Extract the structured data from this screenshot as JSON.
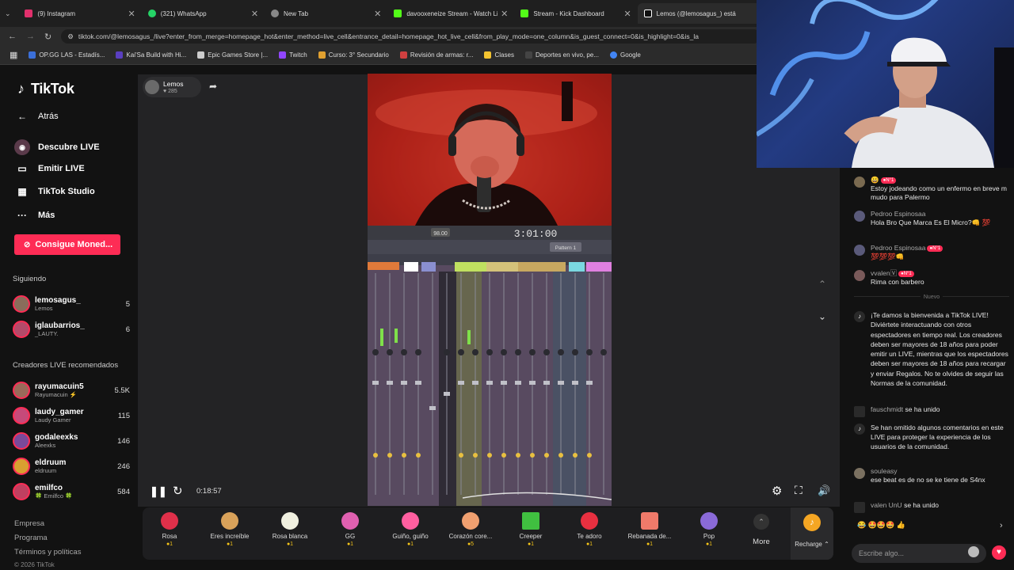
{
  "browser": {
    "tabs": [
      {
        "label": "(9) Instagram",
        "color": "#e1306c"
      },
      {
        "label": "(321) WhatsApp",
        "color": "#25d366"
      },
      {
        "label": "New Tab",
        "color": "#888888"
      },
      {
        "label": "davooxeneize Stream - Watch Live",
        "color": "#53fc18"
      },
      {
        "label": "Stream - Kick Dashboard",
        "color": "#53fc18"
      },
      {
        "label": "Lemos (@lemosagus_) está",
        "color": "#ffffff"
      }
    ],
    "url": "tiktok.com/@lemosagus_/live?enter_from_merge=homepage_hot&enter_method=live_cell&entrance_detail=homepage_hot_live_cell&from_play_mode=one_column&is_guest_connect=0&is_highlight=0&is_la",
    "bookmarks": [
      {
        "label": "OP.GG LAS - Estadís...",
        "color": "#3b6fd8"
      },
      {
        "label": "Kai'Sa Build with Hi...",
        "color": "#5a3fc0"
      },
      {
        "label": "Epic Games Store |...",
        "color": "#cccccc"
      },
      {
        "label": "Twitch",
        "color": "#9146ff"
      },
      {
        "label": "Curso: 3° Secundario",
        "color": "#e0a030"
      },
      {
        "label": "Revisión de armas: r...",
        "color": "#d04040"
      },
      {
        "label": "Clases",
        "color": "#f4c430"
      },
      {
        "label": "Deportes en vivo, pe...",
        "color": "#444444"
      },
      {
        "label": "Google",
        "color": "#4285f4"
      }
    ]
  },
  "sidebar": {
    "logo": "TikTok",
    "nav": [
      {
        "label": "Atrás",
        "icon": "arrow-left-icon",
        "glyph": "←"
      },
      {
        "label": "Descubre LIVE",
        "icon": "live-icon",
        "glyph": "◉"
      },
      {
        "label": "Emitir LIVE",
        "icon": "camera-icon",
        "glyph": "▭"
      },
      {
        "label": "TikTok Studio",
        "icon": "studio-icon",
        "glyph": "▦"
      },
      {
        "label": "Más",
        "icon": "more-icon",
        "glyph": "···"
      }
    ],
    "coins_button": "Consigue Moned...",
    "following_header": "Siguiendo",
    "following": [
      {
        "name": "lemosagus_",
        "sub": "Lemos",
        "count": "5",
        "color": "#8a6d5b"
      },
      {
        "name": "iglaubarrios_",
        "sub": "_LAUTY.",
        "count": "6",
        "color": "#b34b6a"
      }
    ],
    "recommended_header": "Creadores LIVE recomendados",
    "recommended": [
      {
        "name": "rayumacuin5",
        "sub": "Rayumacuin ⚡",
        "count": "5.5K",
        "color": "#9a6a5a"
      },
      {
        "name": "laudy_gamer",
        "sub": "Laudy Gamer",
        "count": "115",
        "color": "#c64a7a"
      },
      {
        "name": "godaleexks",
        "sub": "Aleexks",
        "count": "146",
        "color": "#7a4a9a"
      },
      {
        "name": "eldruum",
        "sub": "eldruum",
        "count": "246",
        "color": "#d9a030"
      },
      {
        "name": "emilfco",
        "sub": "🍀 Emilfco 🍀",
        "count": "584",
        "color": "#c04060"
      }
    ],
    "footer": [
      "Empresa",
      "Programa",
      "Términos y políticas",
      "© 2026 TikTok"
    ]
  },
  "player": {
    "host_name": "Lemos",
    "host_likes": "♥ 285",
    "time": "0:18:57",
    "fl_timer": "3:01:00",
    "fl_pattern": "Pattern 1",
    "fl_tempo": "98.00"
  },
  "gifts": [
    {
      "name": "Rosa",
      "coins": "●1",
      "color": "#e0304a"
    },
    {
      "name": "Eres increíble",
      "coins": "●1",
      "color": "#d9a25a"
    },
    {
      "name": "Rosa blanca",
      "coins": "●1",
      "color": "#f0f0e0"
    },
    {
      "name": "GG",
      "coins": "●1",
      "color": "#e060b0"
    },
    {
      "name": "Guiño, guiño",
      "coins": "●1",
      "color": "#ff5fa0"
    },
    {
      "name": "Corazón core...",
      "coins": "●5",
      "color": "#f0a070"
    },
    {
      "name": "Creeper",
      "coins": "●1",
      "color": "#40c040"
    },
    {
      "name": "Te adoro",
      "coins": "●1",
      "color": "#e83040"
    },
    {
      "name": "Rebanada de...",
      "coins": "●1",
      "color": "#f07a6a"
    },
    {
      "name": "Pop",
      "coins": "●1",
      "color": "#8a6ad8"
    }
  ],
  "gift_more": "More",
  "recharge": "Recharge ⌃",
  "chat": {
    "messages": [
      {
        "user": "",
        "badge": "●N°1",
        "text": "Estoy jodeando como un enfermo en breve m mudo para Palermo",
        "color": "#7a6a50"
      },
      {
        "user": "Pedroo Espinosaa",
        "badge": "",
        "text": "Hola Bro Que Marca Es El Micro?👊 💯",
        "color": "#5a5a7a"
      },
      {
        "user": "Pedroo Espinosaa",
        "badge": "●N°1",
        "text": "💯💯💯👊",
        "color": "#5a5a7a"
      },
      {
        "user": "vvalen🅅",
        "badge": "●N°1",
        "text": "Rima con barbero",
        "color": "#7a5a5a"
      }
    ],
    "new_label": "Nuevo",
    "welcome": "¡Te damos la bienvenida a TikTok LIVE! Diviértete interactuando con otros espectadores en tiempo real. Los creadores deben ser mayores de 18 años para poder emitir un LIVE, mientras que los espectadores deben ser mayores de 18 años para recargar y enviar Regalos. No te olvides de seguir las Normas de la comunidad.",
    "join1_user": "fauschmidt",
    "join1_text": "se ha unido",
    "omitted": "Se han omitido algunos comentarios en este LIVE para proteger la experiencia de los usuarios de la comunidad.",
    "msg5_user": "souleasy",
    "msg5_text": "ese beat es de no se ke tiene de S4nx",
    "join2_user": "valen UnU",
    "join2_text": "se ha unido",
    "quick_emojis": "😂  🤩🤩🤩  👍",
    "placeholder": "Escribe algo..."
  }
}
